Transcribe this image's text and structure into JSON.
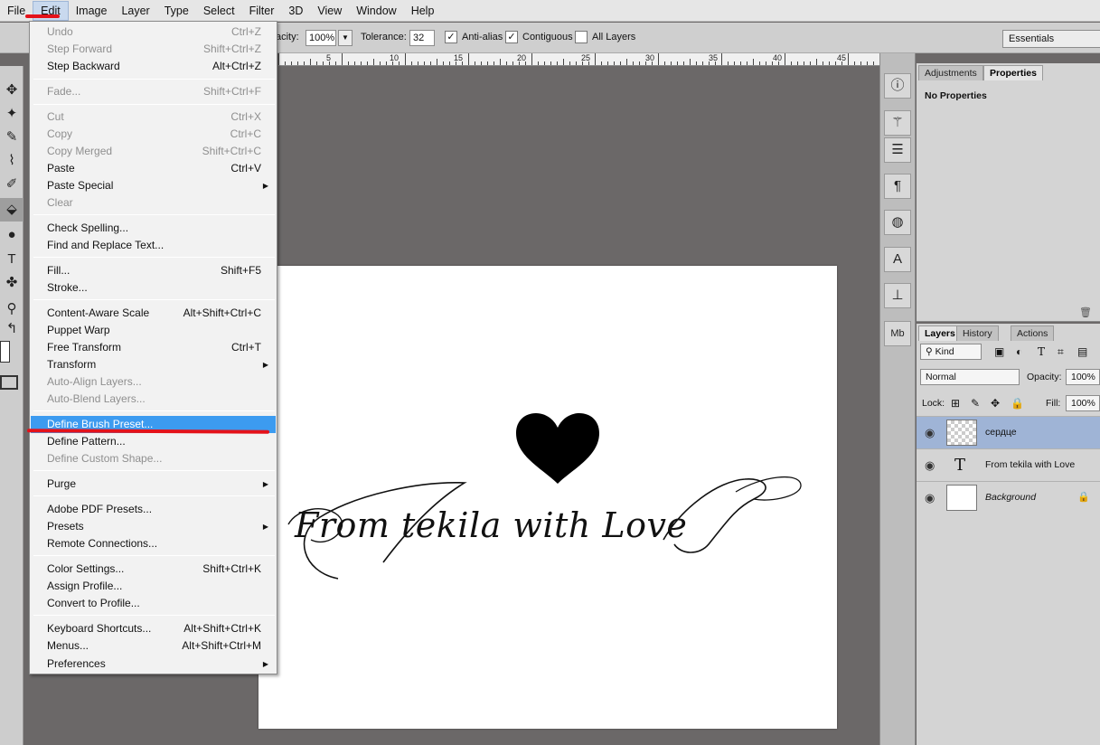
{
  "menubar": {
    "items": [
      "File",
      "Edit",
      "Image",
      "Layer",
      "Type",
      "Select",
      "Filter",
      "3D",
      "View",
      "Window",
      "Help"
    ]
  },
  "options": {
    "opacity_label": "acity:",
    "opacity_value": "100%",
    "tolerance_label": "Tolerance:",
    "tolerance_value": "32",
    "antialias_label": "Anti-alias",
    "contiguous_label": "Contiguous",
    "all_layers_label": "All Layers",
    "workspace": "Essentials"
  },
  "ruler": {
    "numbers": [
      "5",
      "10",
      "15",
      "20",
      "25",
      "30",
      "35",
      "40",
      "45"
    ]
  },
  "edit_menu": {
    "undo": {
      "label": "Undo",
      "shortcut": "Ctrl+Z"
    },
    "step_forward": {
      "label": "Step Forward",
      "shortcut": "Shift+Ctrl+Z"
    },
    "step_backward": {
      "label": "Step Backward",
      "shortcut": "Alt+Ctrl+Z"
    },
    "fade": {
      "label": "Fade...",
      "shortcut": "Shift+Ctrl+F"
    },
    "cut": {
      "label": "Cut",
      "shortcut": "Ctrl+X"
    },
    "copy": {
      "label": "Copy",
      "shortcut": "Ctrl+C"
    },
    "copy_merged": {
      "label": "Copy Merged",
      "shortcut": "Shift+Ctrl+C"
    },
    "paste": {
      "label": "Paste",
      "shortcut": "Ctrl+V"
    },
    "paste_special": {
      "label": "Paste Special"
    },
    "clear": {
      "label": "Clear"
    },
    "check_spelling": {
      "label": "Check Spelling..."
    },
    "find_replace": {
      "label": "Find and Replace Text..."
    },
    "fill": {
      "label": "Fill...",
      "shortcut": "Shift+F5"
    },
    "stroke": {
      "label": "Stroke..."
    },
    "content_aware": {
      "label": "Content-Aware Scale",
      "shortcut": "Alt+Shift+Ctrl+C"
    },
    "puppet_warp": {
      "label": "Puppet Warp"
    },
    "free_transform": {
      "label": "Free Transform",
      "shortcut": "Ctrl+T"
    },
    "transform": {
      "label": "Transform"
    },
    "auto_align": {
      "label": "Auto-Align Layers..."
    },
    "auto_blend": {
      "label": "Auto-Blend Layers..."
    },
    "define_brush": {
      "label": "Define Brush Preset..."
    },
    "define_pattern": {
      "label": "Define Pattern..."
    },
    "define_shape": {
      "label": "Define Custom Shape..."
    },
    "purge": {
      "label": "Purge"
    },
    "pdf_presets": {
      "label": "Adobe PDF Presets..."
    },
    "presets": {
      "label": "Presets"
    },
    "remote": {
      "label": "Remote Connections..."
    },
    "color_settings": {
      "label": "Color Settings...",
      "shortcut": "Shift+Ctrl+K"
    },
    "assign_profile": {
      "label": "Assign Profile..."
    },
    "convert_profile": {
      "label": "Convert to Profile..."
    },
    "keyboard": {
      "label": "Keyboard Shortcuts...",
      "shortcut": "Alt+Shift+Ctrl+K"
    },
    "menus": {
      "label": "Menus...",
      "shortcut": "Alt+Shift+Ctrl+M"
    },
    "preferences": {
      "label": "Preferences"
    }
  },
  "canvas": {
    "text": "From tekila with Love"
  },
  "props_panel": {
    "tab_adjustments": "Adjustments",
    "tab_properties": "Properties",
    "no_properties": "No Properties"
  },
  "layers_panel": {
    "tab_layers": "Layers",
    "tab_history": "History",
    "tab_actions": "Actions",
    "kind": "Kind",
    "blend_mode": "Normal",
    "opacity_label": "Opacity:",
    "opacity_value": "100%",
    "lock_label": "Lock:",
    "fill_label": "Fill:",
    "fill_value": "100%",
    "layers": [
      {
        "name": "сердце"
      },
      {
        "name": "From tekila with Love"
      },
      {
        "name": "Background"
      }
    ]
  },
  "colors": {
    "highlight": "#3c9bf0",
    "annotation": "#e4121a",
    "selected_layer": "#9fb4d6"
  }
}
